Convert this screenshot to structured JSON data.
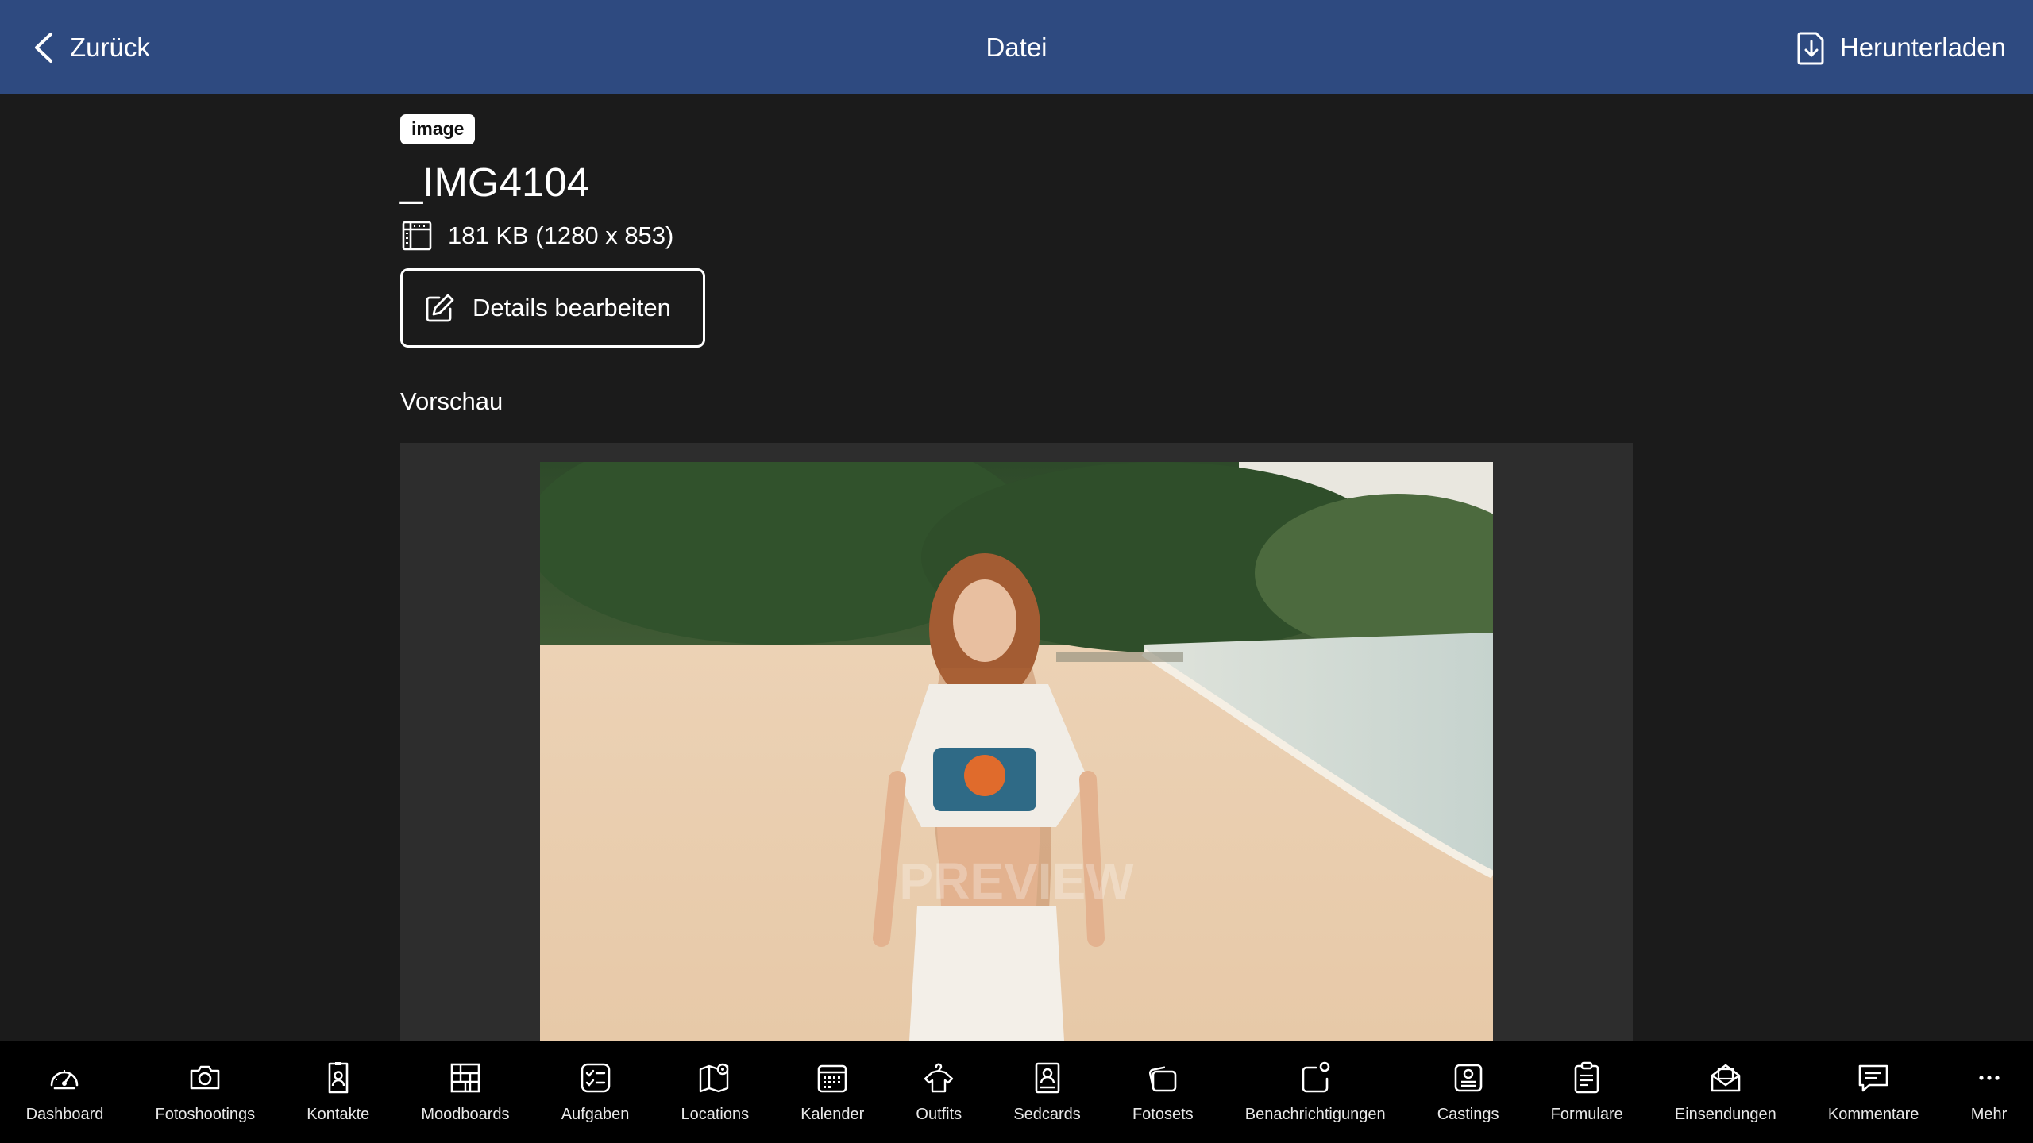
{
  "header": {
    "back_label": "Zurück",
    "title": "Datei",
    "download_label": "Herunterladen",
    "bar_color": "#2e4a80"
  },
  "file": {
    "type_badge": "image",
    "name": "_IMG4104",
    "size_info": "181 KB (1280 x 853)",
    "edit_label": "Details bearbeiten",
    "preview_label": "Vorschau",
    "watermark": "PREVIEW"
  },
  "nav": {
    "items": [
      {
        "label": "Dashboard",
        "icon": "gauge-icon"
      },
      {
        "label": "Fotoshootings",
        "icon": "camera-icon"
      },
      {
        "label": "Kontakte",
        "icon": "contact-card-icon"
      },
      {
        "label": "Moodboards",
        "icon": "moodboard-grid-icon"
      },
      {
        "label": "Aufgaben",
        "icon": "checklist-icon"
      },
      {
        "label": "Locations",
        "icon": "map-pin-icon"
      },
      {
        "label": "Kalender",
        "icon": "calendar-icon"
      },
      {
        "label": "Outfits",
        "icon": "shirt-hanger-icon"
      },
      {
        "label": "Sedcards",
        "icon": "portrait-card-icon"
      },
      {
        "label": "Fotosets",
        "icon": "photo-stack-icon"
      },
      {
        "label": "Benachrichtigungen",
        "icon": "notification-icon"
      },
      {
        "label": "Castings",
        "icon": "casting-card-icon"
      },
      {
        "label": "Formulare",
        "icon": "clipboard-form-icon"
      },
      {
        "label": "Einsendungen",
        "icon": "mail-inbox-icon"
      },
      {
        "label": "Kommentare",
        "icon": "comment-icon"
      },
      {
        "label": "Mehr",
        "icon": "more-dots-icon"
      }
    ]
  }
}
